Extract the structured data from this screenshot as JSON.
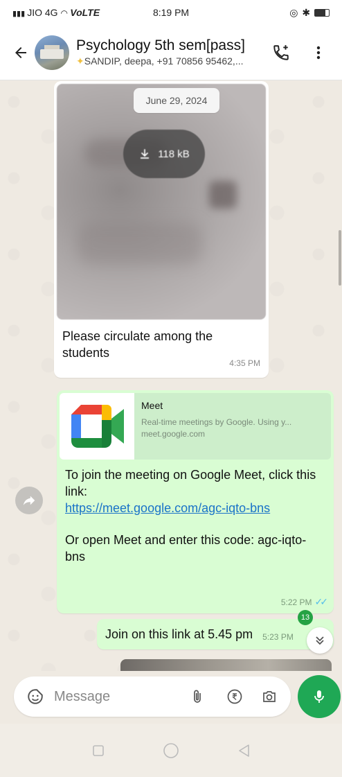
{
  "status_bar": {
    "carrier": "JIO 4G",
    "network": "VoLTE",
    "time": "8:19 PM"
  },
  "header": {
    "title": "Psychology 5th sem[pass]",
    "subtitle": "SANDIP, deepa, +91 70856 95462,..."
  },
  "messages": {
    "date_chip": "June 29, 2024",
    "document": {
      "size": "118 kB",
      "caption": "Please circulate among the students",
      "time": "4:35 PM"
    },
    "meet_message": {
      "preview_title": "Meet",
      "preview_description": "Real-time meetings by Google. Using y...",
      "preview_domain": "meet.google.com",
      "text_intro": "To join the meeting on Google Meet, click this link:",
      "link": "https://meet.google.com/agc-iqto-bns",
      "text_code": "Or open Meet and enter this code: agc-iqto-bns",
      "time": "5:22 PM"
    },
    "join_message": {
      "text": "Join on this link at 5.45 pm",
      "time": "5:23 PM"
    },
    "unread_count": "13"
  },
  "composer": {
    "placeholder": "Message"
  },
  "colors": {
    "outgoing_bubble": "#d9fdd3",
    "incoming_bubble": "#ffffff",
    "accent_green": "#1fa855",
    "link_blue": "#1a73c8",
    "read_ticks": "#53bdeb"
  },
  "icons": {
    "back": "arrow-left-icon",
    "call": "add-call-icon",
    "menu": "more-vertical-icon",
    "download": "download-icon",
    "forward": "forward-icon",
    "scroll_down": "double-chevron-down-icon",
    "emoji": "sticker-icon",
    "attach": "paperclip-icon",
    "payment": "rupee-icon",
    "camera": "camera-icon",
    "mic": "mic-icon"
  }
}
